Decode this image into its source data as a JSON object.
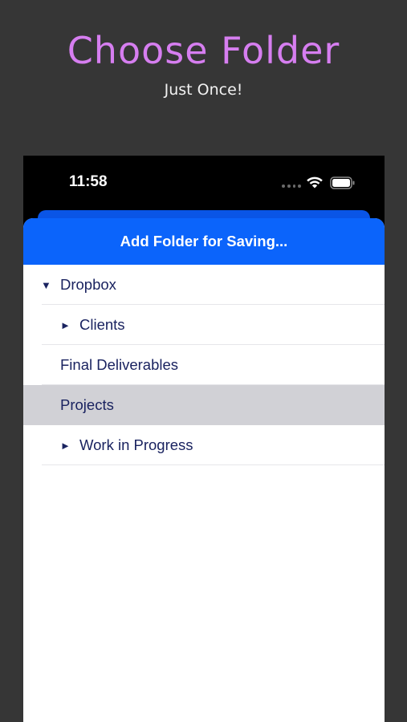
{
  "promo": {
    "title": "Choose Folder",
    "subtitle": "Just Once!"
  },
  "status_bar": {
    "time": "11:58"
  },
  "sheet": {
    "title": "Add Folder for Saving...",
    "items": [
      {
        "label": "Dropbox",
        "disclosure": "▼",
        "level": 0,
        "selected": false
      },
      {
        "label": "Clients",
        "disclosure": "►",
        "level": 1,
        "selected": false
      },
      {
        "label": "Final Deliverables",
        "disclosure": "",
        "level": 1,
        "selected": false
      },
      {
        "label": "Projects",
        "disclosure": "",
        "level": 1,
        "selected": true
      },
      {
        "label": "Work in Progress",
        "disclosure": "►",
        "level": 1,
        "selected": false
      }
    ]
  },
  "colors": {
    "background": "#363636",
    "title": "#d67ef0",
    "accent_blue": "#0b64fb",
    "text_navy": "#1a2360",
    "selected_row": "#d1d1d6"
  },
  "icons": {
    "wifi": "wifi-icon",
    "battery": "battery-icon",
    "signal": "cellular-dots-icon",
    "expanded": "triangle-down-icon",
    "collapsed": "triangle-right-icon"
  }
}
